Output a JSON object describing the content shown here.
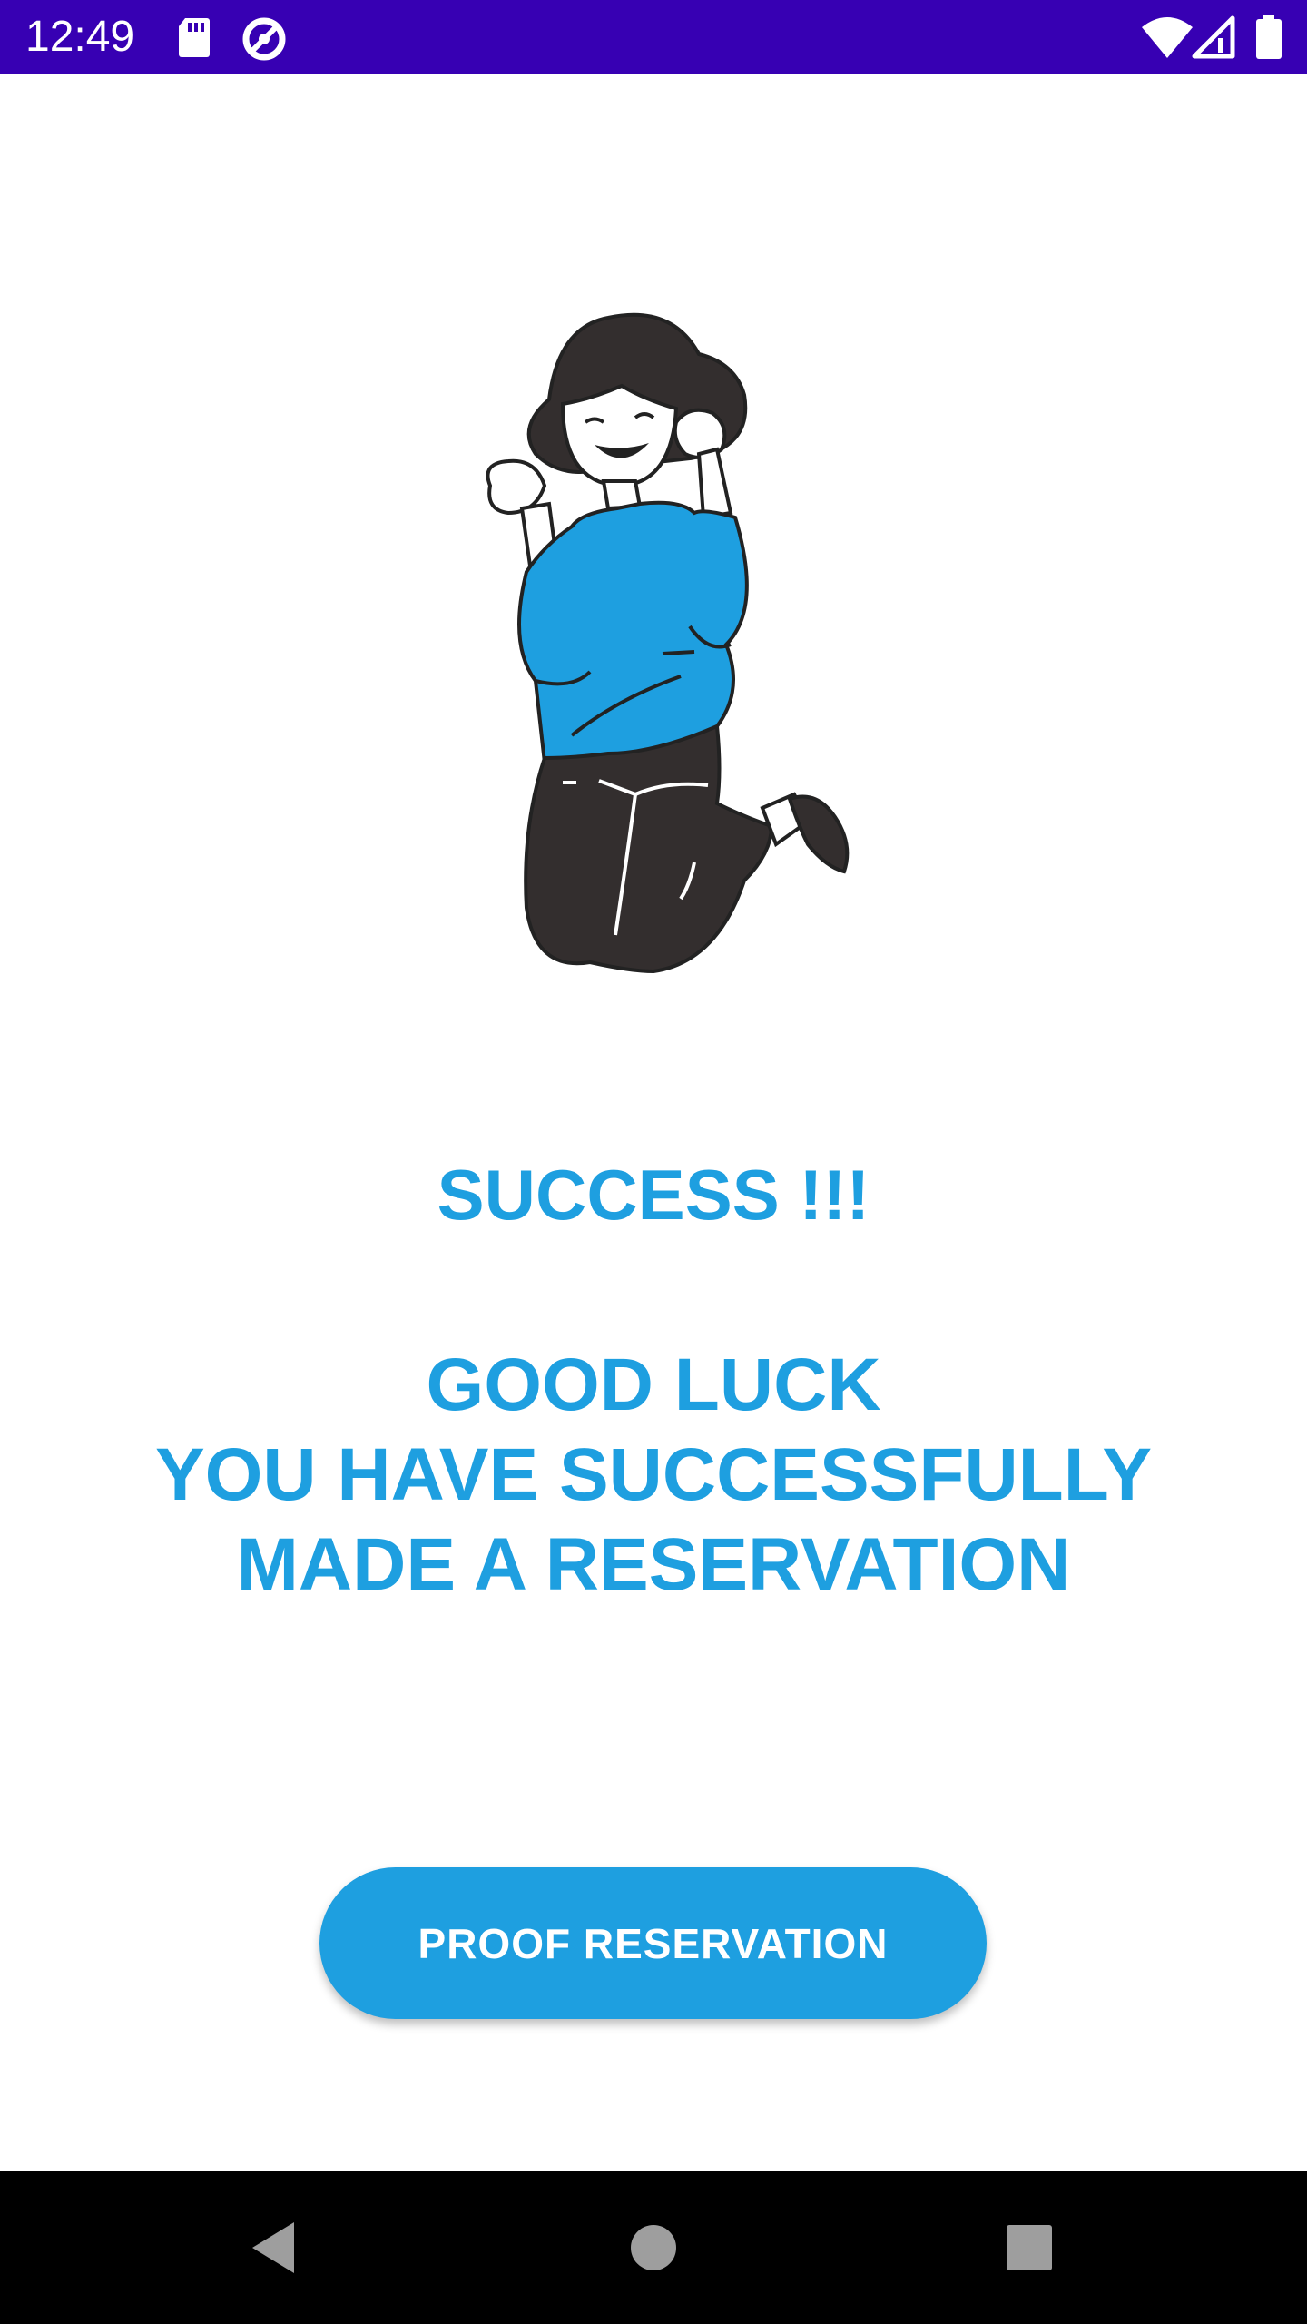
{
  "status_bar": {
    "time": "12:49",
    "icons": [
      "sd-card-icon",
      "data-saver-icon",
      "wifi-icon",
      "cell-signal-icon",
      "battery-icon"
    ],
    "background": "#3700b3"
  },
  "illustration": {
    "name": "jumping-girl-illustration",
    "sweater_color": "#1e9fe0"
  },
  "content": {
    "success_title": "SUCCESS !!!",
    "message_lines": [
      "GOOD LUCK",
      "YOU HAVE SUCCESSFULLY",
      "MADE A RESERVATION"
    ],
    "text_color": "#1e9fe0"
  },
  "button": {
    "label": "PROOF RESERVATION",
    "color": "#1e9fe0"
  },
  "nav_bar": {
    "buttons": [
      "back-icon",
      "home-icon",
      "recents-icon"
    ]
  }
}
